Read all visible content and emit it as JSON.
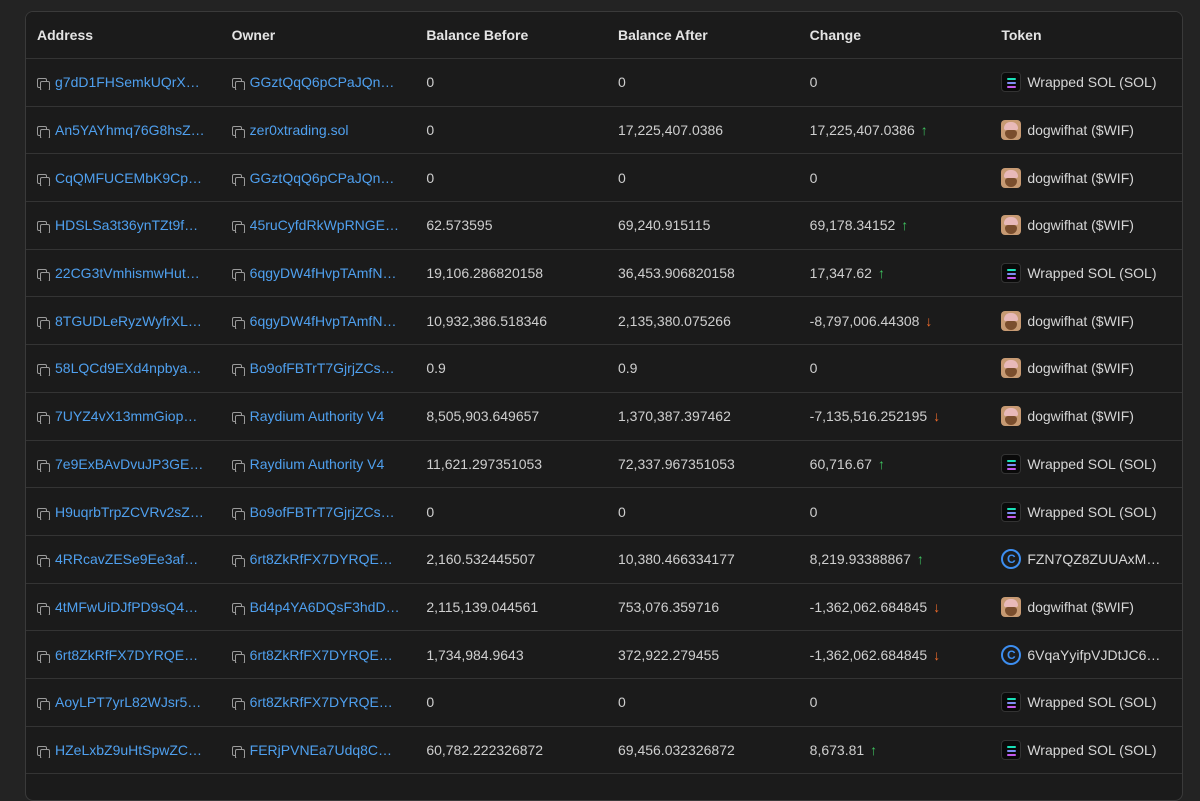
{
  "columns": [
    "Address",
    "Owner",
    "Balance Before",
    "Balance After",
    "Change",
    "Token"
  ],
  "colors": {
    "link": "#4fa0ef",
    "up": "#3ec25f",
    "down": "#ef6a2a",
    "background": "#1b1b1b"
  },
  "rows": [
    {
      "address": "g7dD1FHSemkUQrX1E...",
      "owner": "GGztQqQ6pCPaJQnNp...",
      "before": "0",
      "after": "0",
      "change": "0",
      "dir": "",
      "token": "Wrapped SOL (SOL)",
      "icon": "sol"
    },
    {
      "address": "An5YAYhmq76G8hsZ7...",
      "owner": "zer0xtrading.sol",
      "before": "0",
      "after": "17,225,407.0386",
      "change": "17,225,407.0386",
      "dir": "up",
      "token": "dogwifhat ($WIF)",
      "icon": "wif"
    },
    {
      "address": "CqQMFUCEMbK9Cp9y...",
      "owner": "GGztQqQ6pCPaJQnNp...",
      "before": "0",
      "after": "0",
      "change": "0",
      "dir": "",
      "token": "dogwifhat ($WIF)",
      "icon": "wif"
    },
    {
      "address": "HDSLSa3t36ynTZt9fV3...",
      "owner": "45ruCyfdRkWpRNGEq...",
      "before": "62.573595",
      "after": "69,240.915115",
      "change": "69,178.34152",
      "dir": "up",
      "token": "dogwifhat ($WIF)",
      "icon": "wif"
    },
    {
      "address": "22CG3tVmhismwHutKc...",
      "owner": "6qgyDW4fHvpTAmfNZ...",
      "before": "19,106.286820158",
      "after": "36,453.906820158",
      "change": "17,347.62",
      "dir": "up",
      "token": "Wrapped SOL (SOL)",
      "icon": "sol"
    },
    {
      "address": "8TGUDLeRyzWyfrXLkA...",
      "owner": "6qgyDW4fHvpTAmfNZ...",
      "before": "10,932,386.518346",
      "after": "2,135,380.075266",
      "change": "-8,797,006.44308",
      "dir": "down",
      "token": "dogwifhat ($WIF)",
      "icon": "wif"
    },
    {
      "address": "58LQCd9EXd4npbyaPA...",
      "owner": "Bo9ofFBTrT7GjrjZCseQ...",
      "before": "0.9",
      "after": "0.9",
      "change": "0",
      "dir": "",
      "token": "dogwifhat ($WIF)",
      "icon": "wif"
    },
    {
      "address": "7UYZ4vX13mmGiopay...",
      "owner": "Raydium Authority V4",
      "before": "8,505,903.649657",
      "after": "1,370,387.397462",
      "change": "-7,135,516.252195",
      "dir": "down",
      "token": "dogwifhat ($WIF)",
      "icon": "wif"
    },
    {
      "address": "7e9ExBAvDvuJP3GE6e...",
      "owner": "Raydium Authority V4",
      "before": "11,621.297351053",
      "after": "72,337.967351053",
      "change": "60,716.67",
      "dir": "up",
      "token": "Wrapped SOL (SOL)",
      "icon": "sol"
    },
    {
      "address": "H9uqrbTrpZCVRv2sZah...",
      "owner": "Bo9ofFBTrT7GjrjZCseQ...",
      "before": "0",
      "after": "0",
      "change": "0",
      "dir": "",
      "token": "Wrapped SOL (SOL)",
      "icon": "sol"
    },
    {
      "address": "4RRcavZESe9Ee3afvvF...",
      "owner": "6rt8ZkRfFX7DYRQECJv...",
      "before": "2,160.532445507",
      "after": "10,380.466334177",
      "change": "8,219.93388867",
      "dir": "up",
      "token": "FZN7QZ8ZUUAxMPfx...",
      "icon": "coin"
    },
    {
      "address": "4tMFwUiDJfPD9sQ4TC...",
      "owner": "Bd4p4YA6DQsF3hdDD...",
      "before": "2,115,139.044561",
      "after": "753,076.359716",
      "change": "-1,362,062.684845",
      "dir": "down",
      "token": "dogwifhat ($WIF)",
      "icon": "wif"
    },
    {
      "address": "6rt8ZkRfFX7DYRQECJv...",
      "owner": "6rt8ZkRfFX7DYRQECJv...",
      "before": "1,734,984.9643",
      "after": "372,922.279455",
      "change": "-1,362,062.684845",
      "dir": "down",
      "token": "6VqaYyifpVJDtJC6sR...",
      "icon": "coin"
    },
    {
      "address": "AoyLPT7yrL82WJsr5Sr...",
      "owner": "6rt8ZkRfFX7DYRQECJv...",
      "before": "0",
      "after": "0",
      "change": "0",
      "dir": "",
      "token": "Wrapped SOL (SOL)",
      "icon": "sol"
    },
    {
      "address": "HZeLxbZ9uHtSpwZC3L...",
      "owner": "FERjPVNEa7Udq8CEv6...",
      "before": "60,782.222326872",
      "after": "69,456.032326872",
      "change": "8,673.81",
      "dir": "up",
      "token": "Wrapped SOL (SOL)",
      "icon": "sol"
    }
  ]
}
